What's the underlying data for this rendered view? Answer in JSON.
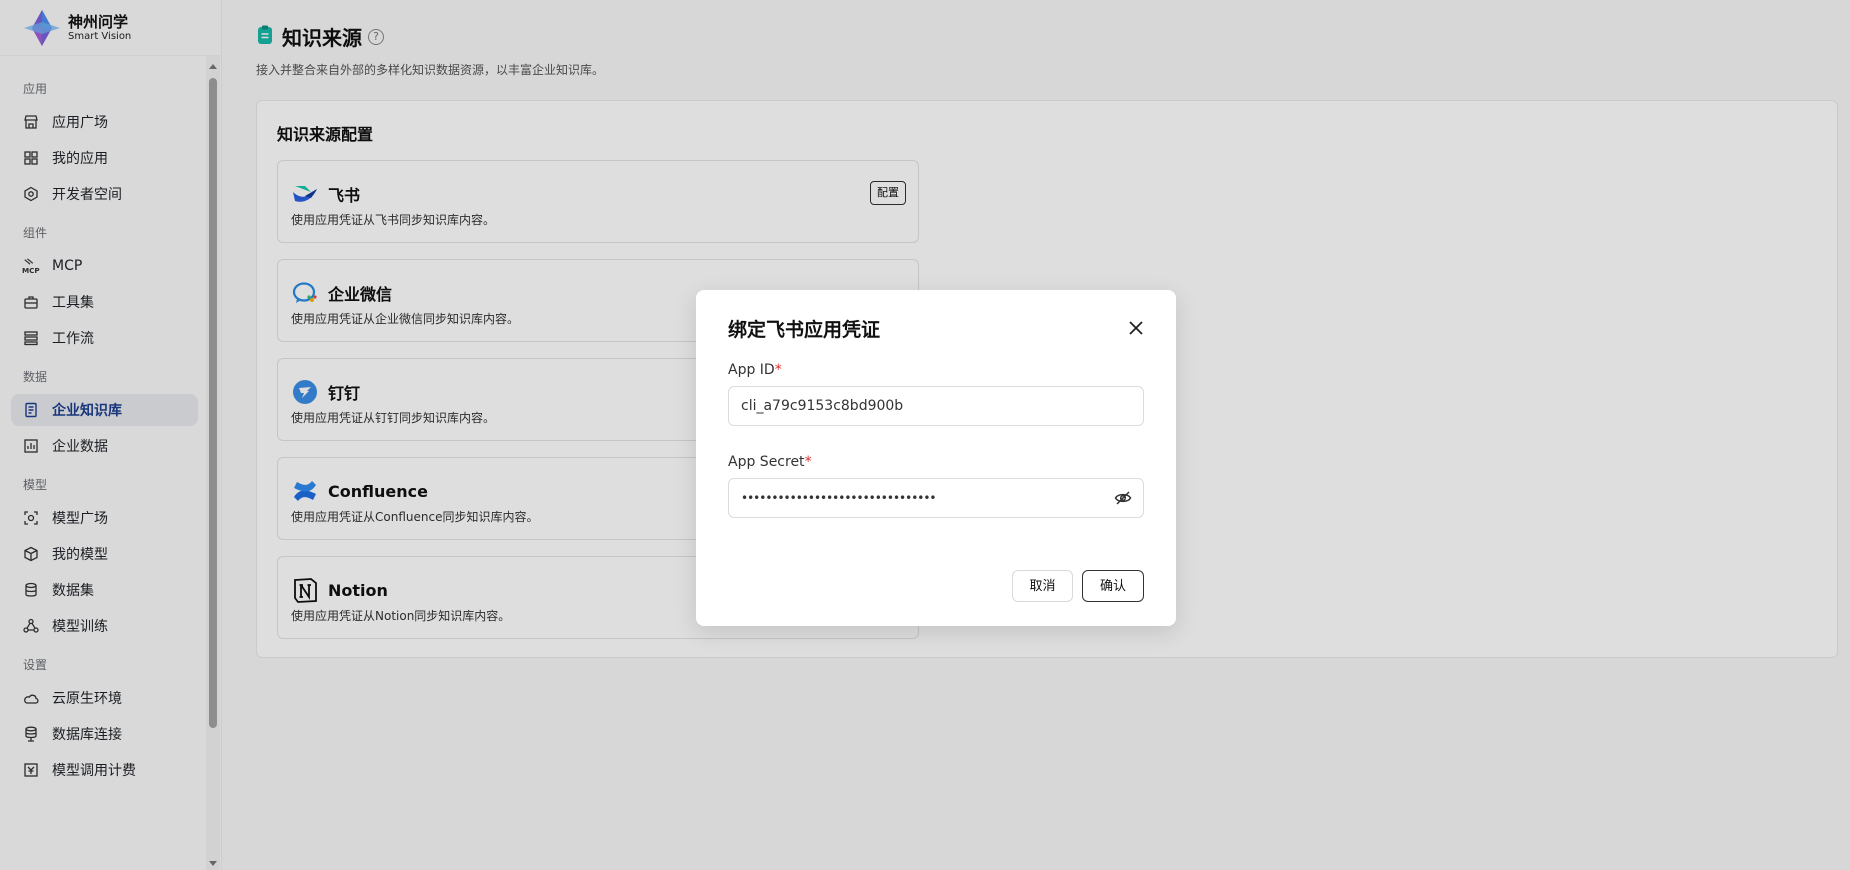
{
  "brand": {
    "title": "神州问学",
    "subtitle": "Smart Vision"
  },
  "sidebar": {
    "groups": [
      {
        "label": "应用",
        "items": [
          {
            "label": "应用广场",
            "icon": "store-icon"
          },
          {
            "label": "我的应用",
            "icon": "apps-grid-icon"
          },
          {
            "label": "开发者空间",
            "icon": "developer-icon"
          }
        ]
      },
      {
        "label": "组件",
        "items": [
          {
            "label": "MCP",
            "icon": "mcp-icon"
          },
          {
            "label": "工具集",
            "icon": "toolbox-icon"
          },
          {
            "label": "工作流",
            "icon": "workflow-icon"
          }
        ]
      },
      {
        "label": "数据",
        "items": [
          {
            "label": "企业知识库",
            "icon": "knowledge-base-icon",
            "active": true
          },
          {
            "label": "企业数据",
            "icon": "chart-icon"
          }
        ]
      },
      {
        "label": "模型",
        "items": [
          {
            "label": "模型广场",
            "icon": "model-plaza-icon"
          },
          {
            "label": "我的模型",
            "icon": "cube-icon"
          },
          {
            "label": "数据集",
            "icon": "database-icon"
          },
          {
            "label": "模型训练",
            "icon": "training-icon"
          }
        ]
      },
      {
        "label": "设置",
        "items": [
          {
            "label": "云原生环境",
            "icon": "cloud-icon"
          },
          {
            "label": "数据库连接",
            "icon": "db-connect-icon"
          },
          {
            "label": "模型调用计费",
            "icon": "billing-icon"
          }
        ]
      }
    ]
  },
  "page": {
    "title": "知识来源",
    "help": "?",
    "description": "接入并整合来自外部的多样化知识数据资源，以丰富企业知识库。"
  },
  "panel": {
    "title": "知识来源配置",
    "sources": [
      {
        "name": "飞书",
        "desc": "使用应用凭证从飞书同步知识库内容。",
        "button": "配置",
        "icon": "feishu-icon"
      },
      {
        "name": "企业微信",
        "desc": "使用应用凭证从企业微信同步知识库内容。",
        "icon": "wecom-icon"
      },
      {
        "name": "钉钉",
        "desc": "使用应用凭证从钉钉同步知识库内容。",
        "icon": "dingtalk-icon"
      },
      {
        "name": "Confluence",
        "desc": "使用应用凭证从Confluence同步知识库内容。",
        "icon": "confluence-icon"
      },
      {
        "name": "Notion",
        "desc": "使用应用凭证从Notion同步知识库内容。",
        "icon": "notion-icon"
      }
    ]
  },
  "modal": {
    "title": "绑定飞书应用凭证",
    "app_id": {
      "label": "App ID",
      "required_mark": "*",
      "value": "cli_a79c9153c8bd900b"
    },
    "app_secret": {
      "label": "App Secret",
      "required_mark": "*",
      "value": "••••••••••••••••••••••••••••••••"
    },
    "cancel": "取消",
    "confirm": "确认"
  },
  "colors": {
    "accent": "#1d3f8f",
    "required": "#e02b2b"
  }
}
